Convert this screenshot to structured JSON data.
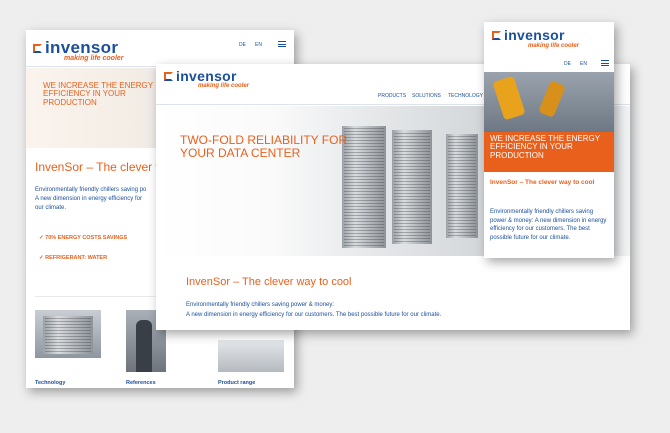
{
  "brand": {
    "name": "invensor",
    "tagline": "making life cooler"
  },
  "colors": {
    "brand_blue": "#1b4f9c",
    "brand_orange": "#e8601c"
  },
  "lang": {
    "de": "DE",
    "en": "EN"
  },
  "nav": {
    "products": "PRODUCTS",
    "solutions": "SOLUTIONS",
    "technology": "TECHNOLOGY"
  },
  "left": {
    "hero": "WE INCREASE THE ENERGY EFFICIENCY IN YOUR PRODUCTION",
    "heading": "InvenSor – The clever wa",
    "line1": "Environmentally friendly chillers saving po",
    "line2": "A new dimension in energy efficiency for",
    "line3": "our climate.",
    "feature1": "70% ENERGY COSTS SAVINGS",
    "feature2": "REFRIGERANT: WATER",
    "tiles": [
      "Technology",
      "References",
      "Product range"
    ]
  },
  "center": {
    "hero": "TWO-FOLD RELIABILITY FOR YOUR DATA CENTER",
    "heading": "InvenSor – The clever way to cool",
    "line1": "Environmentally friendly chillers saving power & money:",
    "line2": "A new dimension in energy efficiency for our customers. The best possible future for our climate."
  },
  "right": {
    "hero": "WE INCREASE THE ENERGY EFFICIENCY IN YOUR PRODUCTION",
    "heading": "InvenSor – The clever way to cool",
    "body": "Environmentally friendly chillers saving power & money: A new dimension in energy efficiency for our customers. The best possible future for our climate."
  }
}
